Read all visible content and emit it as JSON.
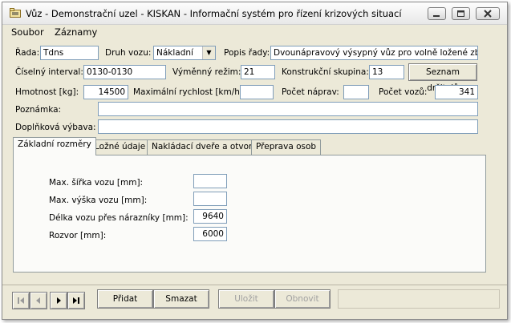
{
  "window": {
    "title": "Vůz - Demonstrační uzel - KISKAN - Informační systém pro řízení krizových situací"
  },
  "menu": {
    "items": [
      {
        "label": "Soubor"
      },
      {
        "label": "Záznamy"
      }
    ]
  },
  "form": {
    "rada": {
      "label": "Řada:",
      "value": "Tdns"
    },
    "druh_vozu": {
      "label": "Druh vozu:",
      "value": "Nákladní"
    },
    "popis_rady": {
      "label": "Popis řady:",
      "value": "Dvounápravový výsypný vůz pro volně ložené zboží s"
    },
    "ciselny_interval": {
      "label": "Číselný interval:",
      "value": "0130-0130"
    },
    "vymenny_rezim": {
      "label": "Výměnný režim:",
      "value": "21"
    },
    "konstrukcni_skupina": {
      "label": "Konstrukční skupina:",
      "value": "13"
    },
    "seznam_drzitelu": {
      "label": "Seznam držitelů"
    },
    "hmotnost": {
      "label": "Hmotnost [kg]:",
      "value": "14500"
    },
    "max_rychlost": {
      "label": "Maximální rychlost [km/h]:",
      "value": ""
    },
    "pocet_naprav": {
      "label": "Počet náprav:",
      "value": ""
    },
    "pocet_vozu": {
      "label": "Počet vozů:",
      "value": "341"
    },
    "poznamka": {
      "label": "Poznámka:",
      "value": ""
    },
    "doplnkova_vybava": {
      "label": "Doplňková výbava:",
      "value": ""
    }
  },
  "tabs": [
    {
      "label": "Základní rozměry"
    },
    {
      "label": "Ložné údaje"
    },
    {
      "label": "Nakládací dveře a otvory"
    },
    {
      "label": "Přeprava osob"
    }
  ],
  "tab_content": {
    "max_sirka": {
      "label": "Max. šířka vozu [mm]:",
      "value": ""
    },
    "max_vyska": {
      "label": "Max. výška vozu [mm]:",
      "value": ""
    },
    "delka": {
      "label": "Délka vozu přes nárazníky [mm]:",
      "value": "9640"
    },
    "rozvor": {
      "label": "Rozvor [mm]:",
      "value": "6000"
    }
  },
  "actions": {
    "pridat": "Přidat",
    "smazat": "Smazat",
    "ulozit": "Uložit",
    "obnovit": "Obnovit"
  },
  "icons": {
    "app": "folder-icon",
    "nav": [
      "first-record-icon",
      "prev-record-icon",
      "next-record-icon",
      "last-record-icon"
    ]
  }
}
